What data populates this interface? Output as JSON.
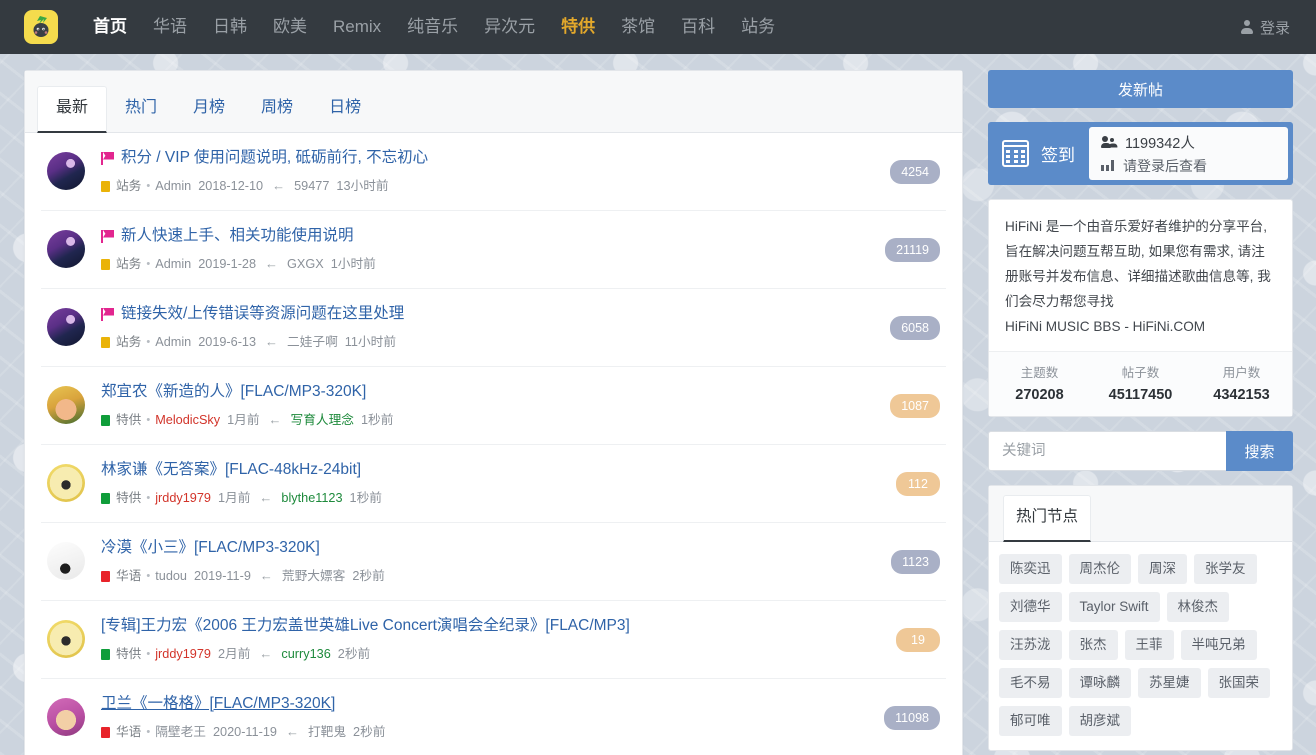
{
  "navbar": {
    "logo_name": "hifini-logo",
    "links": [
      {
        "label": "首页",
        "state": "active"
      },
      {
        "label": "华语",
        "state": "normal"
      },
      {
        "label": "日韩",
        "state": "normal"
      },
      {
        "label": "欧美",
        "state": "normal"
      },
      {
        "label": "Remix",
        "state": "normal"
      },
      {
        "label": "纯音乐",
        "state": "normal"
      },
      {
        "label": "异次元",
        "state": "normal"
      },
      {
        "label": "特供",
        "state": "special"
      },
      {
        "label": "茶馆",
        "state": "normal"
      },
      {
        "label": "百科",
        "state": "normal"
      },
      {
        "label": "站务",
        "state": "normal"
      }
    ],
    "login_label": "登录"
  },
  "colors": {
    "navbar_bg": "#343a40",
    "accent_blue": "#5b8bc9",
    "link_blue": "#2f63a8",
    "special_gold": "#e3a82b",
    "node_zhanwu": "#eab308",
    "node_tegong": "#0f9d3a",
    "node_huayu": "#e8232a",
    "badge_gray": "#a9b0c6",
    "badge_tan": "#efc897",
    "flag_pink": "#e2268f"
  },
  "tabs": [
    {
      "label": "最新",
      "active": true
    },
    {
      "label": "热门",
      "active": false
    },
    {
      "label": "月榜",
      "active": false
    },
    {
      "label": "周榜",
      "active": false
    },
    {
      "label": "日榜",
      "active": false
    }
  ],
  "topics": [
    {
      "title": "积分 / VIP 使用问题说明, 砥砺前行, 不忘初心",
      "flag": true,
      "underline": false,
      "node": "站务",
      "node_color": "#eab308",
      "author": "Admin",
      "author_color": "#8b9199",
      "date": "2018-12-10",
      "arrow": "←",
      "last_user": "59477",
      "last_user_color": "#8b9199",
      "last_time": "13小时前",
      "badge": "4254",
      "badge_color": "#a9b0c6",
      "avatar": "mountain-purple"
    },
    {
      "title": "新人快速上手、相关功能使用说明",
      "flag": true,
      "underline": false,
      "node": "站务",
      "node_color": "#eab308",
      "author": "Admin",
      "author_color": "#8b9199",
      "date": "2019-1-28",
      "arrow": "←",
      "last_user": "GXGX",
      "last_user_color": "#8b9199",
      "last_time": "1小时前",
      "badge": "21119",
      "badge_color": "#a9b0c6",
      "avatar": "mountain-purple"
    },
    {
      "title": "链接失效/上传错误等资源问题在这里处理",
      "flag": true,
      "underline": false,
      "node": "站务",
      "node_color": "#eab308",
      "author": "Admin",
      "author_color": "#8b9199",
      "date": "2019-6-13",
      "arrow": "←",
      "last_user": "二娃子啊",
      "last_user_color": "#8b9199",
      "last_time": "11小时前",
      "badge": "6058",
      "badge_color": "#a9b0c6",
      "avatar": "mountain-purple"
    },
    {
      "title": "郑宜农《新造的人》[FLAC/MP3-320K]",
      "flag": false,
      "underline": false,
      "node": "特供",
      "node_color": "#0f9d3a",
      "author": "MelodicSky",
      "author_color": "#d2342a",
      "date": "1月前",
      "arrow": "←",
      "last_user": "写育人理念",
      "last_user_color": "#1e8a3c",
      "last_time": "1秒前",
      "badge": "1087",
      "badge_color": "#efc897",
      "avatar": "orange-face"
    },
    {
      "title": "林家谦《无答案》[FLAC-48kHz-24bit]",
      "flag": false,
      "underline": false,
      "node": "特供",
      "node_color": "#0f9d3a",
      "author": "jrddy1979",
      "author_color": "#d2342a",
      "date": "1月前",
      "arrow": "←",
      "last_user": "blythe1123",
      "last_user_color": "#1e8a3c",
      "last_time": "1秒前",
      "badge": "112",
      "badge_color": "#efc897",
      "avatar": "yellow-angel"
    },
    {
      "title": "冷漠《小三》[FLAC/MP3-320K]",
      "flag": false,
      "underline": false,
      "node": "华语",
      "node_color": "#e8232a",
      "author": "tudou",
      "author_color": "#8b9199",
      "date": "2019-11-9",
      "arrow": "←",
      "last_user": "荒野大嫖客",
      "last_user_color": "#8b9199",
      "last_time": "2秒前",
      "badge": "1123",
      "badge_color": "#a9b0c6",
      "avatar": "white-bird"
    },
    {
      "title": "[专辑]王力宏《2006 王力宏盖世英雄Live Concert演唱会全纪录》[FLAC/MP3]",
      "flag": false,
      "underline": false,
      "node": "特供",
      "node_color": "#0f9d3a",
      "author": "jrddy1979",
      "author_color": "#d2342a",
      "date": "2月前",
      "arrow": "←",
      "last_user": "curry136",
      "last_user_color": "#1e8a3c",
      "last_time": "2秒前",
      "badge": "19",
      "badge_color": "#efc897",
      "avatar": "yellow-angel"
    },
    {
      "title": "卫兰《一格格》[FLAC/MP3-320K]",
      "flag": false,
      "underline": true,
      "node": "华语",
      "node_color": "#e8232a",
      "author": "隔壁老王",
      "author_color": "#8b9199",
      "date": "2020-11-19",
      "arrow": "←",
      "last_user": "打靶鬼",
      "last_user_color": "#8b9199",
      "last_time": "2秒前",
      "badge": "11098",
      "badge_color": "#a9b0c6",
      "avatar": "pink-girl"
    }
  ],
  "sidebar": {
    "new_post_label": "发新帖",
    "checkin": {
      "label": "签到",
      "people_count": "1199342人",
      "login_hint": "请登录后查看"
    },
    "info": {
      "lines": [
        "HiFiNi 是一个由音乐爱好者维护的分享平台, 旨在解决问题互帮互助, 如果您有需求, 请注册账号并发布信息、详细描述歌曲信息等, 我们会尽力帮您寻找",
        "HiFiNi MUSIC BBS - HiFiNi.COM"
      ]
    },
    "stats": [
      {
        "label": "主题数",
        "value": "270208"
      },
      {
        "label": "帖子数",
        "value": "45117450"
      },
      {
        "label": "用户数",
        "value": "4342153"
      }
    ],
    "search": {
      "placeholder": "关键词",
      "value": "",
      "button_label": "搜索"
    },
    "nodes": {
      "tab_label": "热门节点",
      "tags": [
        "陈奕迅",
        "周杰伦",
        "周深",
        "张学友",
        "刘德华",
        "Taylor Swift",
        "林俊杰",
        "汪苏泷",
        "张杰",
        "王菲",
        "半吨兄弟",
        "毛不易",
        "谭咏麟",
        "苏星婕",
        "张国荣",
        "郁可唯",
        "胡彦斌"
      ]
    }
  }
}
